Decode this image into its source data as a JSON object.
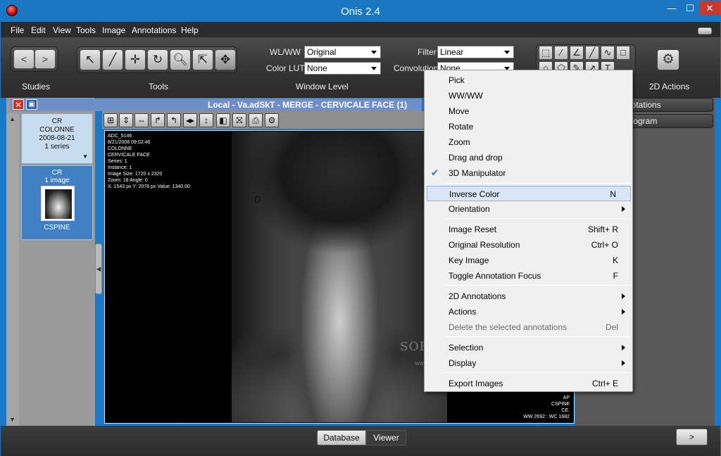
{
  "window": {
    "title": "Onis 2.4",
    "min": "—",
    "max": "☐",
    "close": "✕"
  },
  "menu": [
    "File",
    "Edit",
    "View",
    "Tools",
    "Image",
    "Annotations",
    "Help"
  ],
  "toolbar": {
    "nav_prev": "<",
    "nav_next": ">",
    "wlww_label": "WL/WW",
    "wlww_value": "Original",
    "color_lut_label": "Color LUT",
    "color_lut_value": "None",
    "filter_label": "Filter",
    "filter_value": "Linear",
    "convolution_label": "Convolution",
    "convolution_value": "None",
    "sections": {
      "studies": "Studies",
      "tools": "Tools",
      "window_level": "Window Level",
      "actions_2d": "2D Actions"
    },
    "tool_icons": [
      "pointer-icon",
      "curve-icon",
      "move-icon",
      "rotate-icon",
      "zoom-icon",
      "drag-drop-icon",
      "3d-manipulator-icon"
    ],
    "annotation_icons": [
      "rect-select-icon",
      "ruler-icon",
      "angle-icon",
      "line-icon",
      "polyline-icon",
      "rectangle-icon",
      "ellipse-icon",
      "polygon-icon",
      "pencil-icon",
      "arrow-icon",
      "text-icon"
    ],
    "gear_icon": "gear-icon"
  },
  "studies": {
    "study": {
      "modality": "CR",
      "description": "COLONNE",
      "date": "2008-08-21",
      "series": "1 series"
    },
    "series_item": {
      "modality": "CR",
      "images": "1 image",
      "label": "CSPINE"
    }
  },
  "viewer": {
    "tab_title": "Local - Va.adSkT - MERGE - CERVICALE FACE (1)",
    "overlay_tl": [
      "ADC_5146",
      "8/21/2008 09:02:46",
      "COLONNE",
      "CERVICALE FACE",
      "Series: 1",
      "Instance: 1",
      "Image Size: 1720 x 2320",
      "Zoom: 18 Angle: 0",
      "X: 1543 px Y: 2078 px Value: 1340.00"
    ],
    "overlay_br": [
      "AP",
      "CSPINE",
      "CE:",
      "WW 2692 : WC 1682"
    ],
    "marker": "D"
  },
  "right_panel": {
    "annotations": "notations",
    "histogram": "stogram"
  },
  "bottom": {
    "database": "Database",
    "viewer": "Viewer",
    "next": ">"
  },
  "context_menu": {
    "items": [
      {
        "label": "Pick",
        "shortcut": ""
      },
      {
        "label": "WW/WW",
        "shortcut": ""
      },
      {
        "label": "Move",
        "shortcut": ""
      },
      {
        "label": "Rotate",
        "shortcut": ""
      },
      {
        "label": "Zoom",
        "shortcut": ""
      },
      {
        "label": "Drag and drop",
        "shortcut": ""
      },
      {
        "label": "3D Manipulator",
        "shortcut": "",
        "checked": true
      },
      {
        "label": "Inverse Color",
        "shortcut": "N",
        "highlighted": true
      },
      {
        "label": "Orientation",
        "shortcut": "",
        "submenu": true
      },
      {
        "label": "Image Reset",
        "shortcut": "Shift+ R"
      },
      {
        "label": "Original Resolution",
        "shortcut": "Ctrl+ O"
      },
      {
        "label": "Key Image",
        "shortcut": "K"
      },
      {
        "label": "Toggle Annotation Focus",
        "shortcut": "F"
      },
      {
        "label": "2D Annotations",
        "shortcut": "",
        "submenu": true
      },
      {
        "label": "Actions",
        "shortcut": "",
        "submenu": true
      },
      {
        "label": "Delete the selected annotations",
        "shortcut": "Del",
        "disabled": true
      },
      {
        "label": "Selection",
        "shortcut": "",
        "submenu": true
      },
      {
        "label": "Display",
        "shortcut": "",
        "submenu": true
      },
      {
        "label": "Export Images",
        "shortcut": "Ctrl+ E"
      }
    ]
  },
  "watermark": "SOFTPEDIA",
  "watermark_url": "www.softpedia.com"
}
